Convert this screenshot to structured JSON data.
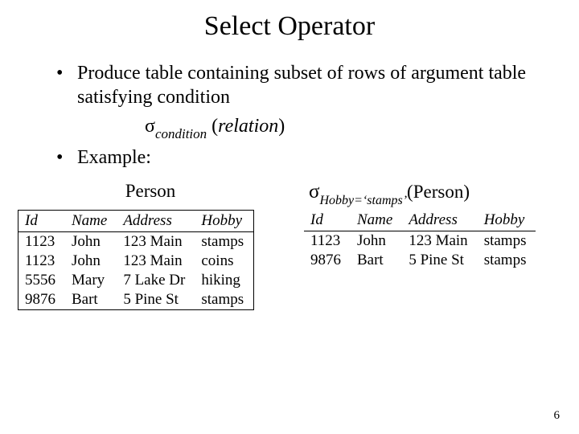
{
  "title": "Select Operator",
  "bullets": {
    "b1_marker": "•",
    "b1_text": "Produce table containing subset of rows of argument table satisfying condition",
    "b2_marker": "•",
    "b2_text": "Example:"
  },
  "notation": {
    "sigma": "σ",
    "sub": "condition",
    "open": "(",
    "rel": "relation",
    "close": ")"
  },
  "left": {
    "title": "Person",
    "headers": {
      "c0": "Id",
      "c1": "Name",
      "c2": "Address",
      "c3": "Hobby"
    },
    "rows": [
      {
        "c0": "1123",
        "c1": "John",
        "c2": "123 Main",
        "c3": "stamps"
      },
      {
        "c0": "1123",
        "c1": "John",
        "c2": "123 Main",
        "c3": "coins"
      },
      {
        "c0": "5556",
        "c1": "Mary",
        "c2": "7 Lake Dr",
        "c3": "hiking"
      },
      {
        "c0": "9876",
        "c1": "Bart",
        "c2": "5 Pine St",
        "c3": "stamps"
      }
    ]
  },
  "right": {
    "expr": {
      "sigma": "σ",
      "sub": "Hobby=‘stamps’",
      "open": "(",
      "rel": "Person",
      "close": ")"
    },
    "headers": {
      "c0": "Id",
      "c1": "Name",
      "c2": "Address",
      "c3": "Hobby"
    },
    "rows": [
      {
        "c0": "1123",
        "c1": "John",
        "c2": "123 Main",
        "c3": "stamps"
      },
      {
        "c0": "9876",
        "c1": "Bart",
        "c2": "5 Pine St",
        "c3": "stamps"
      }
    ]
  },
  "page_number": "6",
  "chart_data": {
    "type": "table",
    "tables": [
      {
        "name": "Person",
        "columns": [
          "Id",
          "Name",
          "Address",
          "Hobby"
        ],
        "rows": [
          [
            "1123",
            "John",
            "123 Main",
            "stamps"
          ],
          [
            "1123",
            "John",
            "123 Main",
            "coins"
          ],
          [
            "5556",
            "Mary",
            "7 Lake Dr",
            "hiking"
          ],
          [
            "9876",
            "Bart",
            "5 Pine St",
            "stamps"
          ]
        ]
      },
      {
        "name": "σ_{Hobby='stamps'}(Person)",
        "columns": [
          "Id",
          "Name",
          "Address",
          "Hobby"
        ],
        "rows": [
          [
            "1123",
            "John",
            "123 Main",
            "stamps"
          ],
          [
            "9876",
            "Bart",
            "5 Pine St",
            "stamps"
          ]
        ]
      }
    ]
  }
}
